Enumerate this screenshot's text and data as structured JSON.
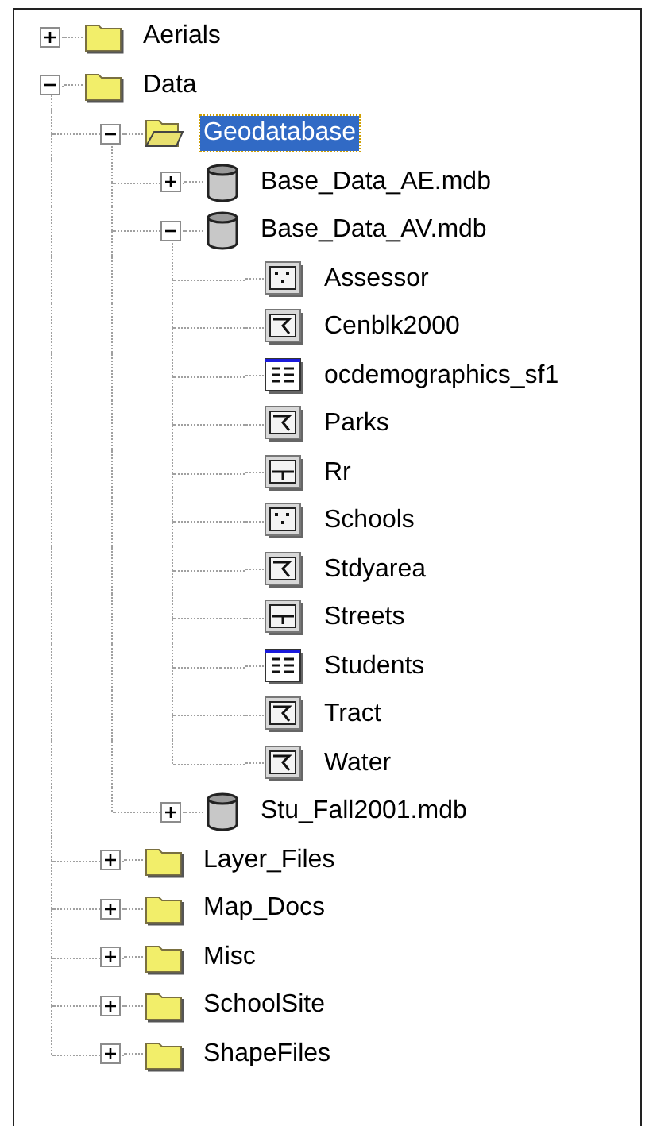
{
  "tree": [
    {
      "label": "Aerials",
      "kind": "folder",
      "expanded": false,
      "selected": false
    },
    {
      "label": "Data",
      "kind": "folder",
      "expanded": true,
      "selected": false,
      "children": [
        {
          "label": "Geodatabase",
          "kind": "folder-open",
          "expanded": true,
          "selected": true,
          "children": [
            {
              "label": "Base_Data_AE.mdb",
              "kind": "database",
              "expanded": false,
              "selected": false
            },
            {
              "label": "Base_Data_AV.mdb",
              "kind": "database",
              "expanded": true,
              "selected": false,
              "children": [
                {
                  "label": "Assessor",
                  "kind": "point",
                  "selected": false
                },
                {
                  "label": "Cenblk2000",
                  "kind": "polygon",
                  "selected": false
                },
                {
                  "label": "ocdemographics_sf1",
                  "kind": "table",
                  "selected": false
                },
                {
                  "label": "Parks",
                  "kind": "polygon",
                  "selected": false
                },
                {
                  "label": "Rr",
                  "kind": "line",
                  "selected": false
                },
                {
                  "label": "Schools",
                  "kind": "point",
                  "selected": false
                },
                {
                  "label": "Stdyarea",
                  "kind": "polygon",
                  "selected": false
                },
                {
                  "label": "Streets",
                  "kind": "line",
                  "selected": false
                },
                {
                  "label": "Students",
                  "kind": "table",
                  "selected": false
                },
                {
                  "label": "Tract",
                  "kind": "polygon",
                  "selected": false
                },
                {
                  "label": "Water",
                  "kind": "polygon",
                  "selected": false
                }
              ]
            },
            {
              "label": "Stu_Fall2001.mdb",
              "kind": "database",
              "expanded": false,
              "selected": false
            }
          ]
        },
        {
          "label": "Layer_Files",
          "kind": "folder",
          "expanded": false,
          "selected": false
        },
        {
          "label": "Map_Docs",
          "kind": "folder",
          "expanded": false,
          "selected": false
        },
        {
          "label": "Misc",
          "kind": "folder",
          "expanded": false,
          "selected": false
        },
        {
          "label": "SchoolSite",
          "kind": "folder",
          "expanded": false,
          "selected": false
        },
        {
          "label": "ShapeFiles",
          "kind": "folder",
          "expanded": false,
          "selected": false
        }
      ]
    }
  ]
}
